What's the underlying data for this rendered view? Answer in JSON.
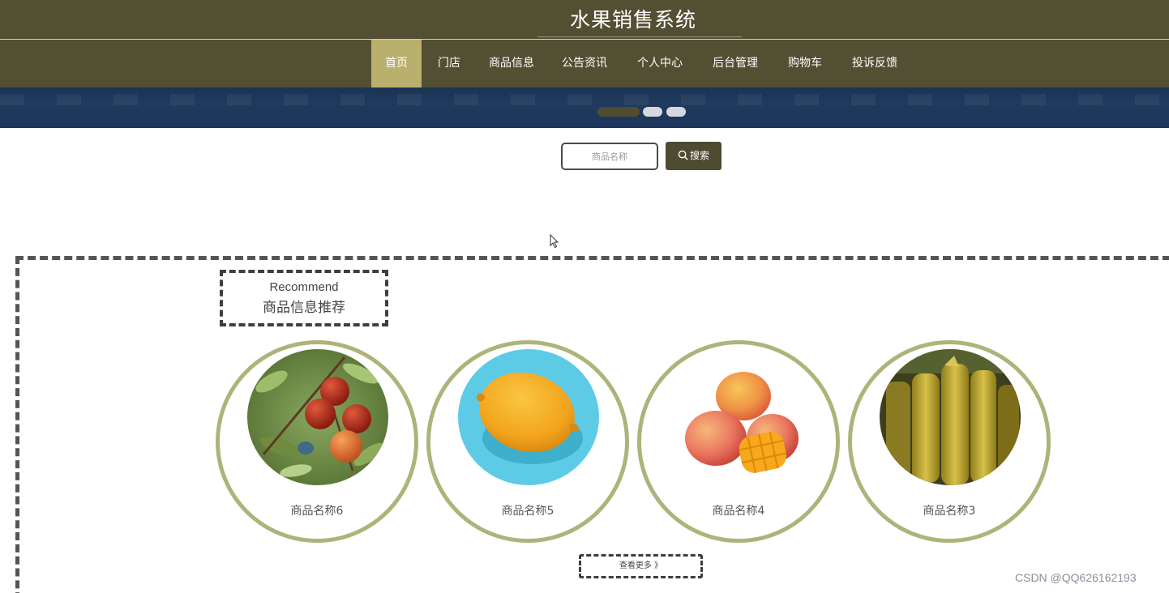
{
  "header": {
    "site_title": "水果销售系统"
  },
  "nav": {
    "items": [
      {
        "label": "首页",
        "active": true
      },
      {
        "label": "门店",
        "active": false
      },
      {
        "label": "商品信息",
        "active": false
      },
      {
        "label": "公告资讯",
        "active": false
      },
      {
        "label": "个人中心",
        "active": false
      },
      {
        "label": "后台管理",
        "active": false
      },
      {
        "label": "购物车",
        "active": false
      },
      {
        "label": "投诉反馈",
        "active": false
      }
    ]
  },
  "banner": {
    "carousel_slides": 3,
    "active_slide": 1
  },
  "search": {
    "placeholder": "商品名称",
    "button_label": "搜索",
    "icon": "search-icon"
  },
  "recommend": {
    "title_en": "Recommend",
    "title_cn": "商品信息推荐",
    "products": [
      {
        "name": "商品名称6",
        "image": "red-dates-on-branch"
      },
      {
        "name": "商品名称5",
        "image": "lemon-on-blue"
      },
      {
        "name": "商品名称4",
        "image": "mangoes"
      },
      {
        "name": "商品名称3",
        "image": "starfruit"
      }
    ],
    "more_label": "查看更多 》"
  },
  "watermark": "CSDN @QQ626162193",
  "colors": {
    "header_bg": "#524f33",
    "nav_active": "#b8b06c",
    "ring": "#aeb37a",
    "banner": "#1f3a5e"
  }
}
